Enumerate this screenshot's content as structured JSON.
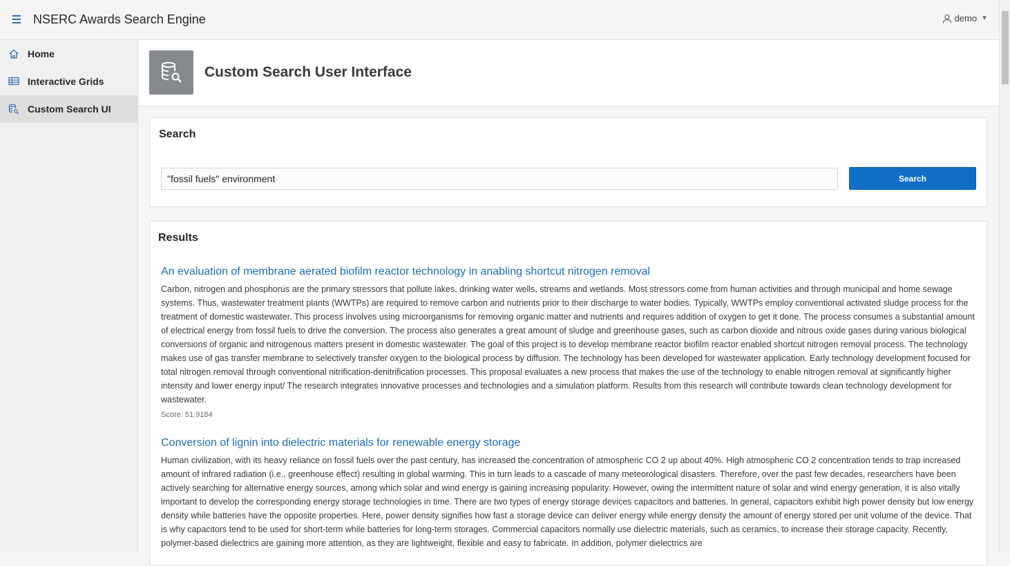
{
  "header": {
    "app_title": "NSERC Awards Search Engine",
    "user": "demo"
  },
  "sidebar": {
    "items": [
      {
        "label": "Home",
        "icon": "home-icon"
      },
      {
        "label": "Interactive Grids",
        "icon": "grid-icon"
      },
      {
        "label": "Custom Search UI",
        "icon": "database-search-icon",
        "active": true
      }
    ]
  },
  "hero": {
    "title": "Custom Search User Interface",
    "icon": "database-search-icon"
  },
  "search": {
    "region_title": "Search",
    "query": "\"fossil fuels\" environment",
    "button_label": "Search"
  },
  "results": {
    "region_title": "Results",
    "items": [
      {
        "title": "An evaluation of membrane aerated biofilm reactor technology in anabling shortcut nitrogen removal",
        "abstract": "Carbon, nitrogen and phosphorus are the primary stressors that pollute lakes, drinking water wells, streams and wetlands. Most stressors come from human activities and through municipal and home sewage systems. Thus, wastewater treatment plants (WWTPs) are required to remove carbon and nutrients prior to their discharge to water bodies. Typically, WWTPs employ conventional activated sludge process for the treatment of domestic wastewater. This process involves using microorganisms for removing organic matter and nutrients and requires addition of oxygen to get it done. The process consumes a substantial amount of electrical energy from fossil fuels to drive the conversion. The process also generates a great amount of sludge and greenhouse gases, such as carbon dioxide and nitrous oxide gases during various biological conversions of organic and nitrogenous matters present in domestic wastewater. The goal of this project is to develop membrane reactor biofilm reactor enabled shortcut nitrogen removal process. The technology makes use of gas transfer membrane to selectively transfer oxygen to the biological process by diffusion. The technology has been developed for wastewater application. Early technology development focused for total nitrogen removal through conventional nitrification-denitrification processes. This proposal evaluates a new process that makes the use of the technology to enable nitrogen removal at significantly higher intensity and lower energy input/ The research integrates innovative processes and technologies and a simulation platform. Results from this research will contribute towards clean technology development for wastewater.",
        "score": "Score: 51.9184"
      },
      {
        "title": "Conversion of lignin into dielectric materials for renewable energy storage",
        "abstract": "Human civilization, with its heavy reliance on fossil fuels over the past century, has increased the concentration of atmospheric CO 2 up about 40%. High atmospheric CO 2 concentration tends to trap increased amount of infrared radiation (i.e., greenhouse effect) resulting in global warming. This in turn leads to a cascade of many meteorological disasters. Therefore, over the past few decades, researchers have been actively searching for alternative energy sources, among which solar and wind energy is gaining increasing popularity. However, owing the intermittent nature of solar and wind energy generation, it is also vitally important to develop the corresponding energy storage technologies in time. There are two types of energy storage devices capacitors and batteries. In general, capacitors exhibit high power density but low energy density while batteries have the opposite properties. Here, power density signifies how fast a storage device can deliver energy while energy density the amount of energy stored per unit volume of the device. That is why capacitors tend to be used for short-term while batteries for long-term storages. Commercial capacitors normally use dielectric materials, such as ceramics, to increase their storage capacity. Recently, polymer-based dielectrics are gaining more attention, as they are lightweight, flexible and easy to fabricate. In addition, polymer dielectrics are"
      }
    ]
  }
}
